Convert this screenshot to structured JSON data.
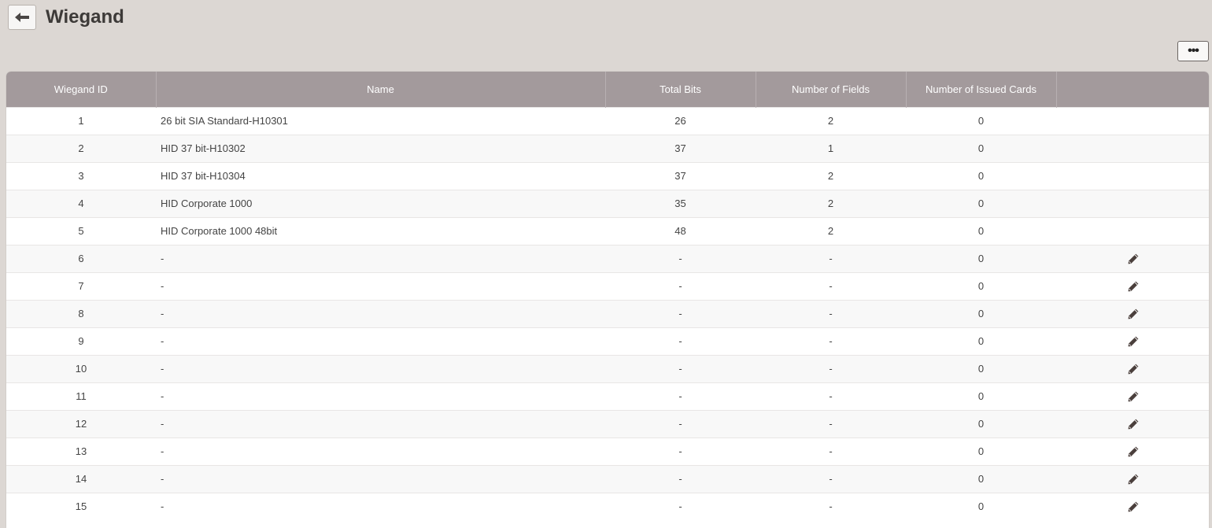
{
  "header": {
    "title": "Wiegand",
    "back_icon": "arrow-left-icon",
    "more_label": "•••"
  },
  "table": {
    "columns": [
      "Wiegand ID",
      "Name",
      "Total Bits",
      "Number of Fields",
      "Number of Issued Cards",
      ""
    ],
    "rows": [
      {
        "id": "1",
        "name": "26 bit SIA Standard-H10301",
        "total_bits": "26",
        "fields": "2",
        "issued": "0",
        "editable": false
      },
      {
        "id": "2",
        "name": "HID 37 bit-H10302",
        "total_bits": "37",
        "fields": "1",
        "issued": "0",
        "editable": false
      },
      {
        "id": "3",
        "name": "HID 37 bit-H10304",
        "total_bits": "37",
        "fields": "2",
        "issued": "0",
        "editable": false
      },
      {
        "id": "4",
        "name": "HID Corporate 1000",
        "total_bits": "35",
        "fields": "2",
        "issued": "0",
        "editable": false
      },
      {
        "id": "5",
        "name": "HID Corporate 1000 48bit",
        "total_bits": "48",
        "fields": "2",
        "issued": "0",
        "editable": false
      },
      {
        "id": "6",
        "name": "-",
        "total_bits": "-",
        "fields": "-",
        "issued": "0",
        "editable": true
      },
      {
        "id": "7",
        "name": "-",
        "total_bits": "-",
        "fields": "-",
        "issued": "0",
        "editable": true
      },
      {
        "id": "8",
        "name": "-",
        "total_bits": "-",
        "fields": "-",
        "issued": "0",
        "editable": true
      },
      {
        "id": "9",
        "name": "-",
        "total_bits": "-",
        "fields": "-",
        "issued": "0",
        "editable": true
      },
      {
        "id": "10",
        "name": "-",
        "total_bits": "-",
        "fields": "-",
        "issued": "0",
        "editable": true
      },
      {
        "id": "11",
        "name": "-",
        "total_bits": "-",
        "fields": "-",
        "issued": "0",
        "editable": true
      },
      {
        "id": "12",
        "name": "-",
        "total_bits": "-",
        "fields": "-",
        "issued": "0",
        "editable": true
      },
      {
        "id": "13",
        "name": "-",
        "total_bits": "-",
        "fields": "-",
        "issued": "0",
        "editable": true
      },
      {
        "id": "14",
        "name": "-",
        "total_bits": "-",
        "fields": "-",
        "issued": "0",
        "editable": true
      },
      {
        "id": "15",
        "name": "-",
        "total_bits": "-",
        "fields": "-",
        "issued": "0",
        "editable": true
      }
    ],
    "edit_icon": "pencil-icon"
  },
  "colors": {
    "background": "#dcd7d3",
    "table_header": "#a39a9c"
  }
}
